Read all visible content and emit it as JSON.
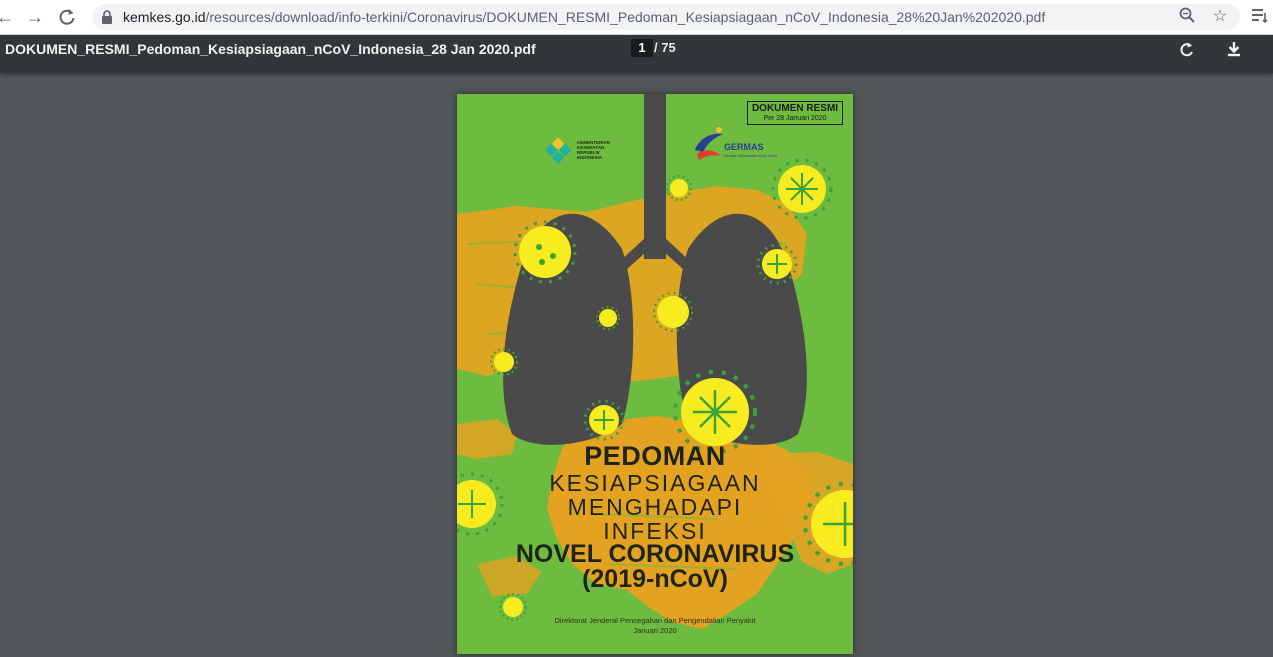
{
  "browser": {
    "url_domain": "kemkes.go.id",
    "url_path": "/resources/download/info-terkini/Coronavirus/DOKUMEN_RESMI_Pedoman_Kesiapsiagaan_nCoV_Indonesia_28%20Jan%202020.pdf",
    "icons": [
      "back-arrow-icon",
      "forward-arrow-icon",
      "reload-icon",
      "lock-icon",
      "zoom-icon",
      "star-icon",
      "reading-list-icon"
    ]
  },
  "viewer": {
    "title": "DOKUMEN_RESMI_Pedoman_Kesiapsiagaan_nCoV_Indonesia_28 Jan 2020.pdf",
    "current_page": "1",
    "total_pages": "/ 75",
    "icons": [
      "rotate-icon",
      "download-icon"
    ]
  },
  "cover": {
    "badge_title": "DOKUMEN RESMI",
    "badge_date": "Per 28 Januari 2020",
    "kemenkes_text": "KEMENTERIAN KESEHATAN REPUBLIK INDONESIA",
    "germas_text": "GERMAS",
    "germas_sub": "Gerakan Masyarakat Hidup Sehat",
    "heading": "PEDOMAN",
    "line1": "KESIAPSIAGAAN",
    "line2": "MENGHADAPI",
    "line3": "INFEKSI",
    "line4": "NOVEL CORONAVIRUS",
    "line5": "(2019-nCoV)",
    "footer_org": "Direktorat Jenderal Pencegahan dan Pengendalian Penyakit",
    "footer_date": "Januari 2020"
  },
  "colors": {
    "cover_green": "#6dbb3f",
    "map_orange": "#e3a321",
    "lungs_gray": "#4a4a4a",
    "virus_yellow": "#f7ec1f",
    "virus_green": "#3aa43a",
    "viewer_bg": "#525659",
    "toolbar": "#323639"
  }
}
